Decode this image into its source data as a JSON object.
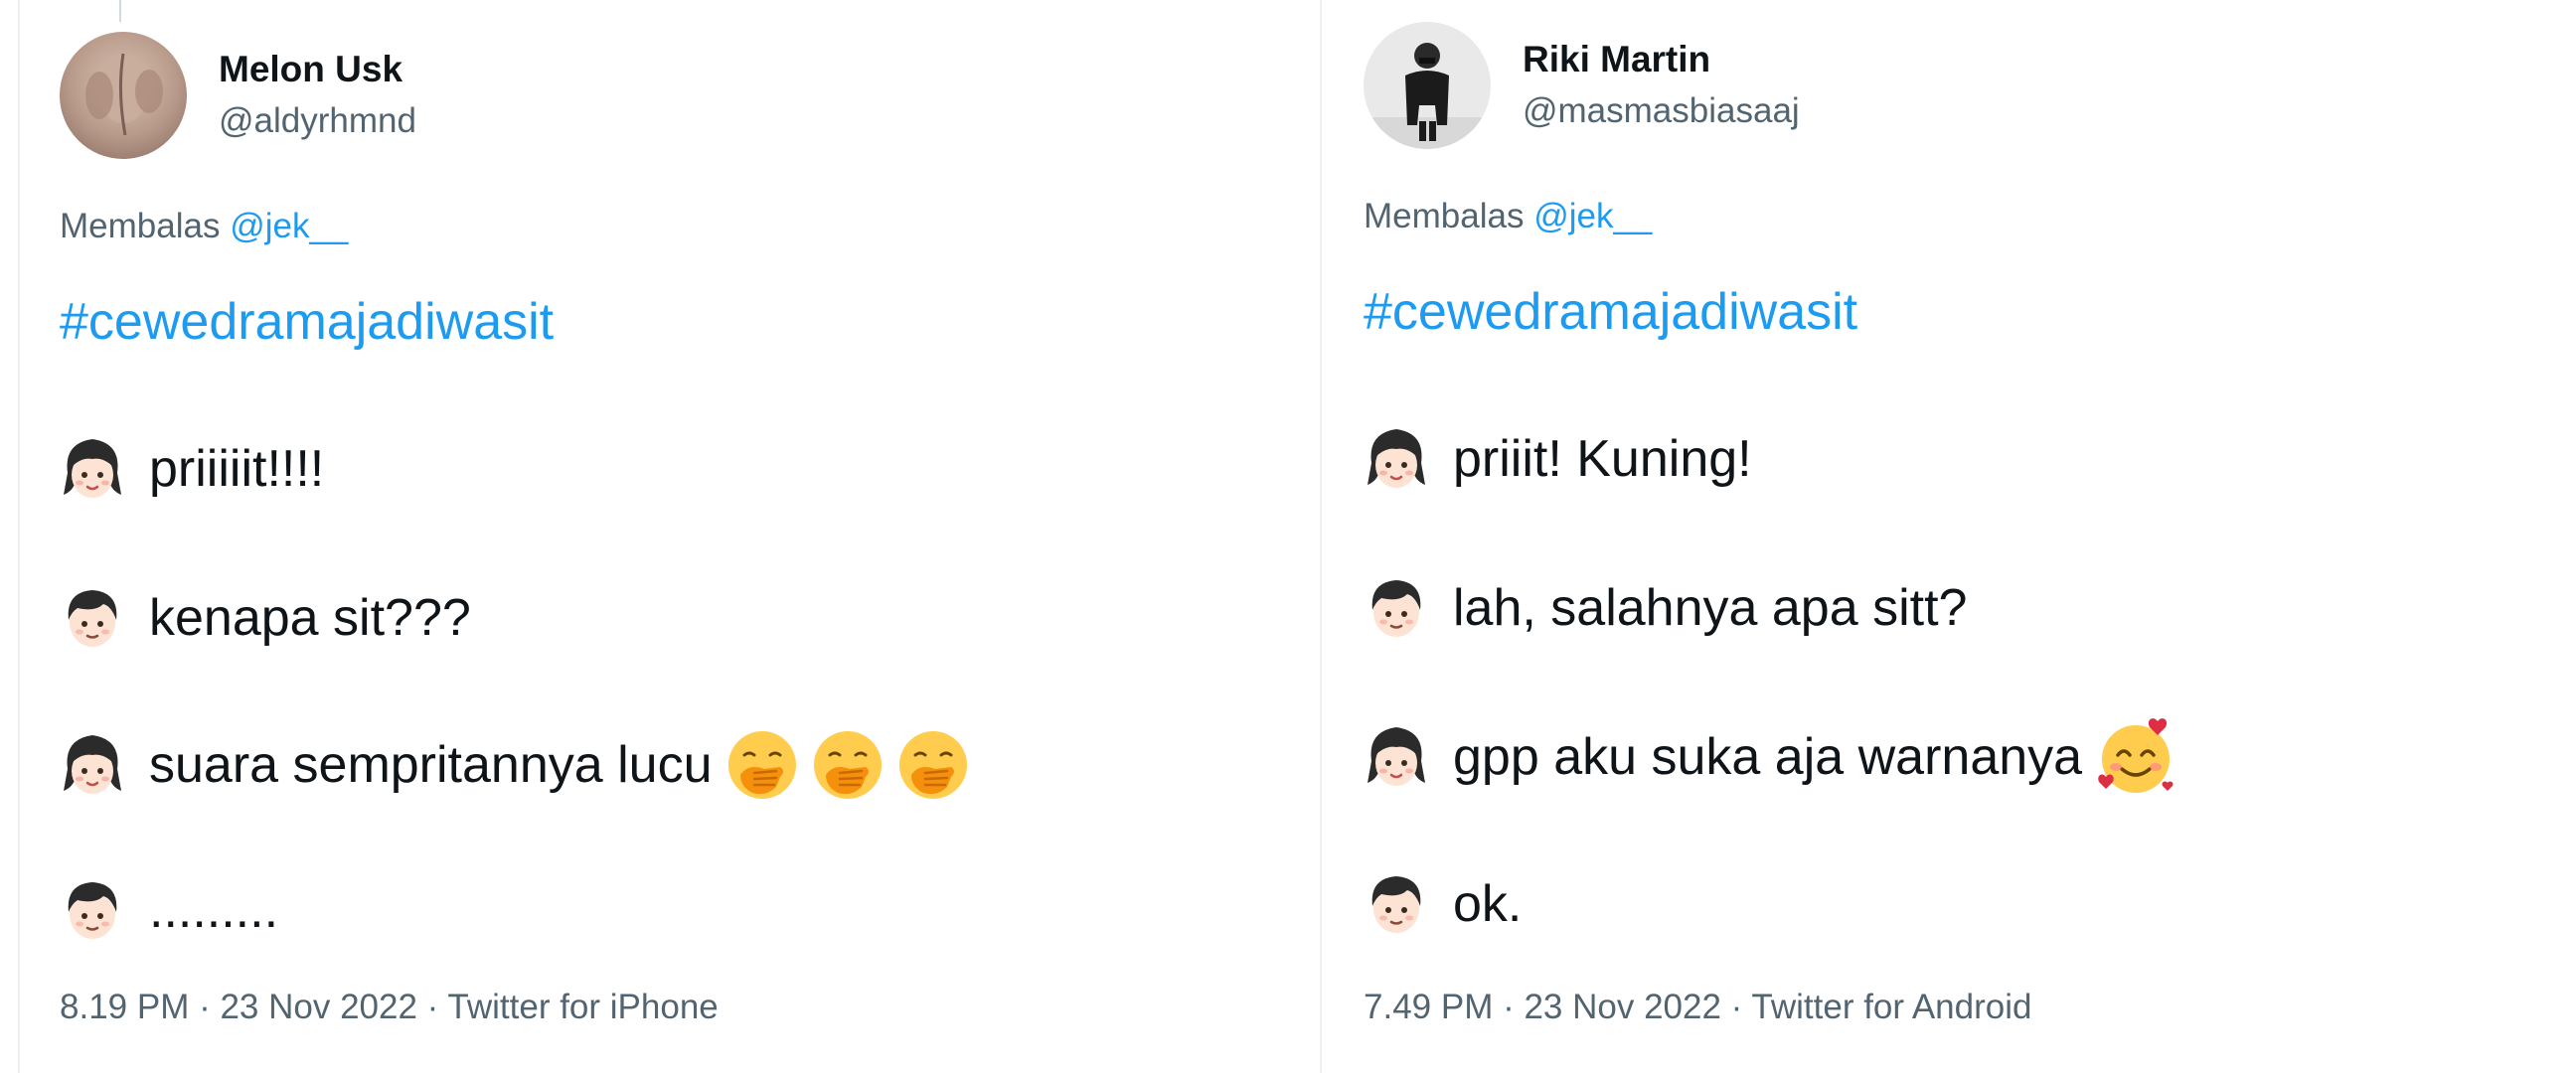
{
  "tweets": [
    {
      "author": {
        "display_name": "Melon Usk",
        "handle": "@aldyrhmnd"
      },
      "reply": {
        "prefix": "Membalas",
        "mention": "@jek__"
      },
      "hashtag": "#cewedramajadiwasit",
      "lines": [
        {
          "speaker": "girl",
          "text": "priiiiit!!!!"
        },
        {
          "speaker": "boy",
          "text": "kenapa sit???"
        },
        {
          "speaker": "girl",
          "text": "suara sempritannya lucu",
          "emoji": [
            "face-with-hand-over-mouth",
            "face-with-hand-over-mouth",
            "face-with-hand-over-mouth"
          ]
        },
        {
          "speaker": "boy",
          "text": "........."
        }
      ],
      "meta": "8.19 PM · 23 Nov 2022 · Twitter for iPhone"
    },
    {
      "author": {
        "display_name": "Riki Martin",
        "handle": "@masmasbiasaaj"
      },
      "reply": {
        "prefix": "Membalas",
        "mention": "@jek__"
      },
      "hashtag": "#cewedramajadiwasit",
      "lines": [
        {
          "speaker": "girl",
          "text": "priiit! Kuning!"
        },
        {
          "speaker": "boy",
          "text": "lah, salahnya apa sitt?"
        },
        {
          "speaker": "girl",
          "text": "gpp aku suka aja warnanya",
          "emoji": [
            "smiling-face-with-hearts"
          ]
        },
        {
          "speaker": "boy",
          "text": "ok."
        }
      ],
      "meta": "7.49 PM · 23 Nov 2022 · Twitter for Android"
    }
  ],
  "colors": {
    "text": "#0f1419",
    "secondary": "#536471",
    "link": "#1d9bf0"
  }
}
